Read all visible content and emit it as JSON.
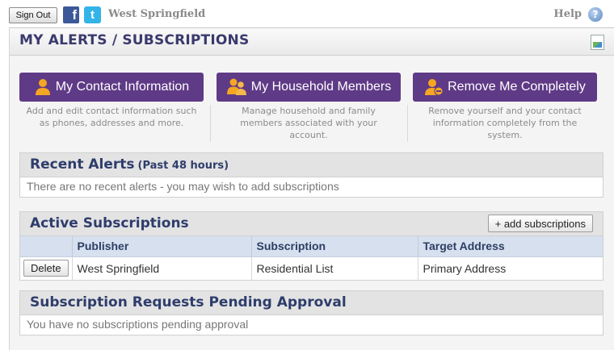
{
  "topbar": {
    "signout_label": "Sign Out",
    "facebook_glyph": "f",
    "twitter_glyph": "t",
    "town": "West Springfield",
    "help_label": "Help",
    "help_glyph": "?"
  },
  "page": {
    "title": "MY ALERTS / SUBSCRIPTIONS"
  },
  "actions": [
    {
      "label": "My Contact Information",
      "icon": "person-icon",
      "description": "Add and edit contact information such as phones, addresses and more."
    },
    {
      "label": "My Household Members",
      "icon": "people-icon",
      "description": "Manage household and family members associated with your account."
    },
    {
      "label": "Remove Me Completely",
      "icon": "person-remove-icon",
      "description": "Remove yourself and your contact information completely from the system."
    }
  ],
  "recent": {
    "title": "Recent Alerts",
    "subtitle": "(Past 48 hours)",
    "message": "There are no recent alerts - you may wish to add subscriptions"
  },
  "active": {
    "title": "Active Subscriptions",
    "add_label": "+ add subscriptions",
    "columns": [
      "",
      "Publisher",
      "Subscription",
      "Target Address"
    ],
    "rows": [
      {
        "action": "Delete",
        "publisher": "West Springfield",
        "subscription": "Residential List",
        "target": "Primary Address"
      }
    ]
  },
  "pending": {
    "title": "Subscription Requests Pending Approval",
    "message": "You have no subscriptions pending approval"
  },
  "colors": {
    "accent_purple": "#5f3a86",
    "header_text": "#2e3d6b",
    "table_header_bg": "#d6e0ef",
    "facebook": "#3b5998",
    "twitter": "#33b4e8"
  }
}
